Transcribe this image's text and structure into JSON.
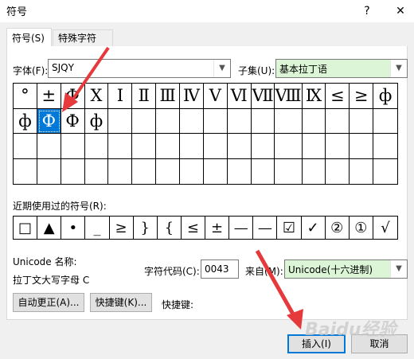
{
  "window": {
    "title": "符号",
    "help_button": "?",
    "close_button": "✕"
  },
  "tabs": [
    {
      "label": "符号(S)"
    },
    {
      "label": "特殊字符(P)"
    }
  ],
  "font": {
    "label": "字体(F):",
    "value": "SJQY"
  },
  "subset": {
    "label": "子集(U):",
    "value": "基本拉丁语"
  },
  "symbol_grid": {
    "rows": [
      [
        "°",
        "±",
        "Φ",
        "Ⅹ",
        "Ⅰ",
        "Ⅱ",
        "Ⅲ",
        "Ⅳ",
        "Ⅴ",
        "Ⅵ",
        "Ⅶ",
        "Ⅷ",
        "Ⅸ",
        "≤",
        "≥",
        "ф"
      ],
      [
        "ф",
        "Ф",
        "Ф",
        "ф",
        "",
        "",
        "",
        "",
        "",
        "",
        "",
        "",
        "",
        "",
        "",
        ""
      ],
      [
        "",
        "",
        "",
        "",
        "",
        "",
        "",
        "",
        "",
        "",
        "",
        "",
        "",
        "",
        "",
        ""
      ],
      [
        "",
        "",
        "",
        "",
        "",
        "",
        "",
        "",
        "",
        "",
        "",
        "",
        "",
        "",
        "",
        ""
      ]
    ],
    "selected": "Ф"
  },
  "recent": {
    "label": "近期使用过的符号(R):",
    "symbols": [
      "□",
      "▲",
      "•",
      "_",
      "≥",
      "}",
      "{",
      "≤",
      "±",
      "—",
      "—",
      "☑",
      "✓",
      "②",
      "①",
      "√"
    ]
  },
  "unicode_name": {
    "label": "Unicode 名称:",
    "value": "拉丁文大写字母 C"
  },
  "char_code": {
    "label": "字符代码(C):",
    "value": "0043"
  },
  "from": {
    "label": "来自(M):",
    "value": "Unicode(十六进制)"
  },
  "buttons": {
    "autocorrect": "自动更正(A)...",
    "shortcut_key": "快捷键(K)...",
    "shortcut_label": "快捷键:",
    "insert": "插入(I)",
    "cancel": "取消"
  },
  "watermark": "Baidu经验",
  "colors": {
    "accent": "#0078d7",
    "green_field": "#dbf5d6",
    "arrow": "#e5393b"
  }
}
